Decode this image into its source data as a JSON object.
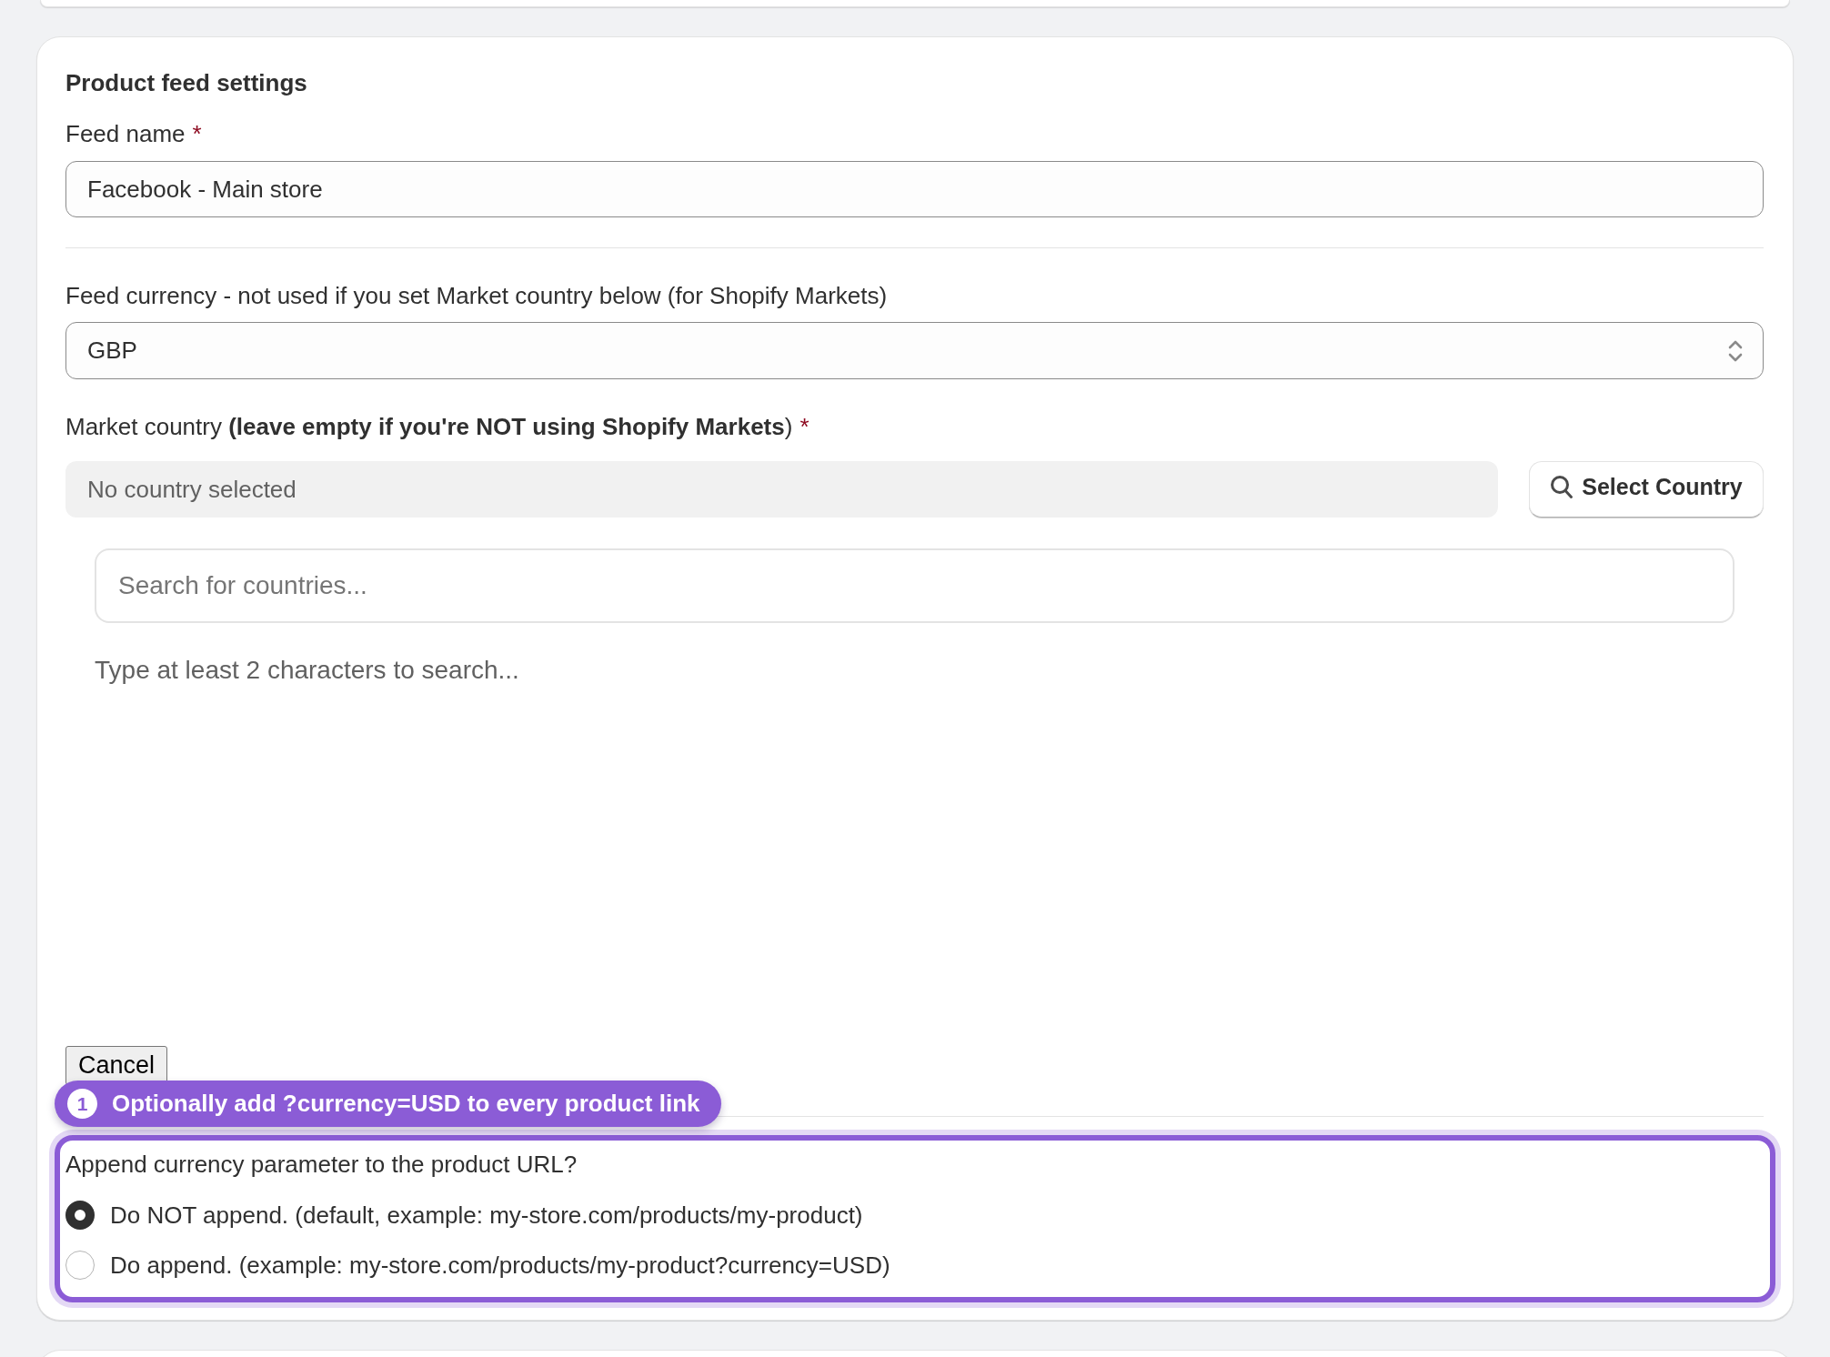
{
  "card": {
    "title": "Product feed settings",
    "feed_name": {
      "label": "Feed name",
      "required_mark": "*",
      "value": "Facebook - Main store"
    },
    "feed_currency": {
      "label": "Feed currency - not used if you set Market country below (for Shopify Markets)",
      "value": "GBP"
    },
    "market_country": {
      "label": "Market country **(leave empty if you're NOT using Shopify Markets**)",
      "required_mark": "*",
      "selection": "No country selected",
      "button": "Select Country",
      "search": {
        "placeholder": "Search for countries..."
      },
      "hint": "Type at least 2 characters to search..."
    },
    "cancel_button": "Cancel",
    "tour_callout": {
      "step": "1",
      "text": "Optionally add ?currency=USD to every product link"
    },
    "append_currency": {
      "highlighted": true,
      "label": "Append currency parameter to the product URL?",
      "options": [
        {
          "label": "Do NOT append. (default, example: my-store.com/products/my-product)",
          "selected": true
        },
        {
          "label": "Do append. (example: my-store.com/products/my-product?currency=USD)",
          "selected": false
        }
      ]
    }
  }
}
